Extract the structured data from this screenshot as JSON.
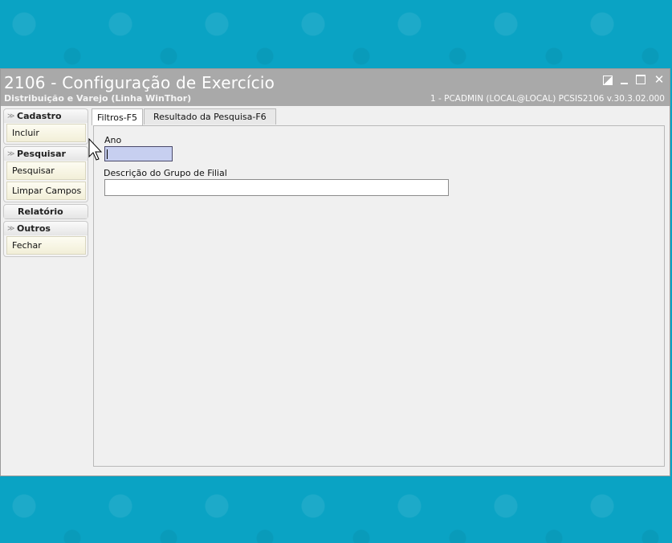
{
  "window": {
    "title": "2106 - Configuração de Exercício",
    "subtitle": "Distribuição e Varejo (Linha WinThor)",
    "user_info": "1 - PCADMIN (LOCAL@LOCAL)   PCSIS2106  v.30.3.02.000"
  },
  "sidebar": {
    "groups": [
      {
        "label": "Cadastro",
        "items": [
          "Incluir"
        ]
      },
      {
        "label": "Pesquisar",
        "items": [
          "Pesquisar",
          "Limpar Campos"
        ]
      },
      {
        "label": "Relatório",
        "items": []
      },
      {
        "label": "Outros",
        "items": [
          "Fechar"
        ]
      }
    ]
  },
  "tabs": [
    {
      "label": "Filtros-F5",
      "active": true
    },
    {
      "label": "Resultado da Pesquisa-F6",
      "active": false
    }
  ],
  "form": {
    "ano_label": "Ano",
    "ano_value": "",
    "grupo_label": "Descrição do Grupo de Filial",
    "grupo_value": ""
  },
  "colors": {
    "background": "#0aa3c4",
    "titlebar": "#a9a9a9",
    "focused_field": "#c7cff0"
  }
}
